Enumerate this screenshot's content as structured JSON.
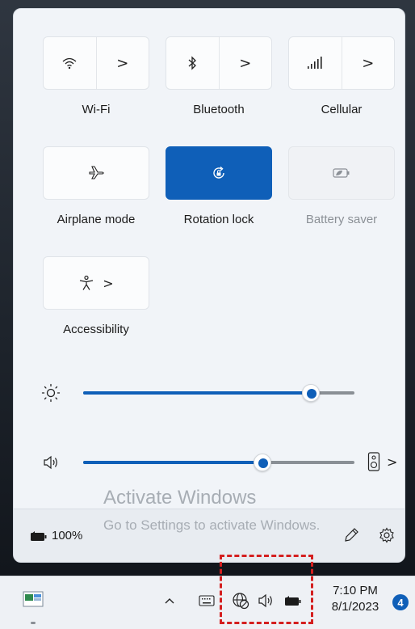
{
  "quick_settings": {
    "wifi": {
      "label": "Wi-Fi",
      "icon": "wifi-icon"
    },
    "bluetooth": {
      "label": "Bluetooth",
      "icon": "bluetooth-icon"
    },
    "cellular": {
      "label": "Cellular",
      "icon": "cellular-signal-icon"
    },
    "airplane": {
      "label": "Airplane mode",
      "icon": "airplane-icon"
    },
    "rotation_lock": {
      "label": "Rotation lock",
      "icon": "rotation-lock-icon",
      "active": true
    },
    "battery_saver": {
      "label": "Battery saver",
      "icon": "battery-saver-icon",
      "disabled": true
    },
    "accessibility": {
      "label": "Accessibility",
      "icon": "accessibility-icon"
    },
    "chevron": ">"
  },
  "sliders": {
    "brightness": {
      "icon": "brightness-icon",
      "level": 0.84
    },
    "volume": {
      "icon": "volume-icon",
      "level": 0.66,
      "output_icon": "speaker-device-icon"
    }
  },
  "footer": {
    "battery_percent": "100%",
    "edit_icon": "pencil-icon",
    "settings_icon": "gear-icon"
  },
  "watermark": {
    "title": "Activate Windows",
    "subtitle": "Go to Settings to activate Windows."
  },
  "taskbar": {
    "time": "7:10 PM",
    "date": "8/1/2023",
    "notification_count": "4",
    "accent_color": "#0f5fb8",
    "highlight_color": "#d41f1f"
  }
}
